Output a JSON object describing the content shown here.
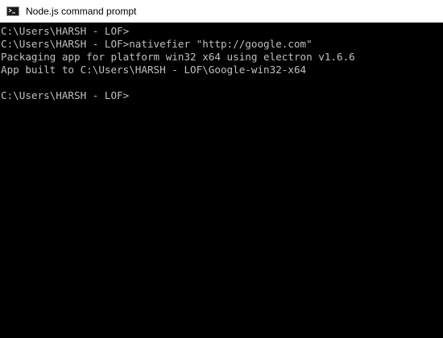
{
  "window": {
    "title": "Node.js command prompt",
    "icon": "command-prompt-icon"
  },
  "console": {
    "text_color": "#c0c0c0",
    "background_color": "#000000",
    "lines": [
      "C:\\Users\\HARSH - LOF>",
      "C:\\Users\\HARSH - LOF>nativefier \"http://google.com\"",
      "Packaging app for platform win32 x64 using electron v1.6.6",
      "App built to C:\\Users\\HARSH - LOF\\Google-win32-x64",
      "",
      "C:\\Users\\HARSH - LOF>"
    ]
  }
}
